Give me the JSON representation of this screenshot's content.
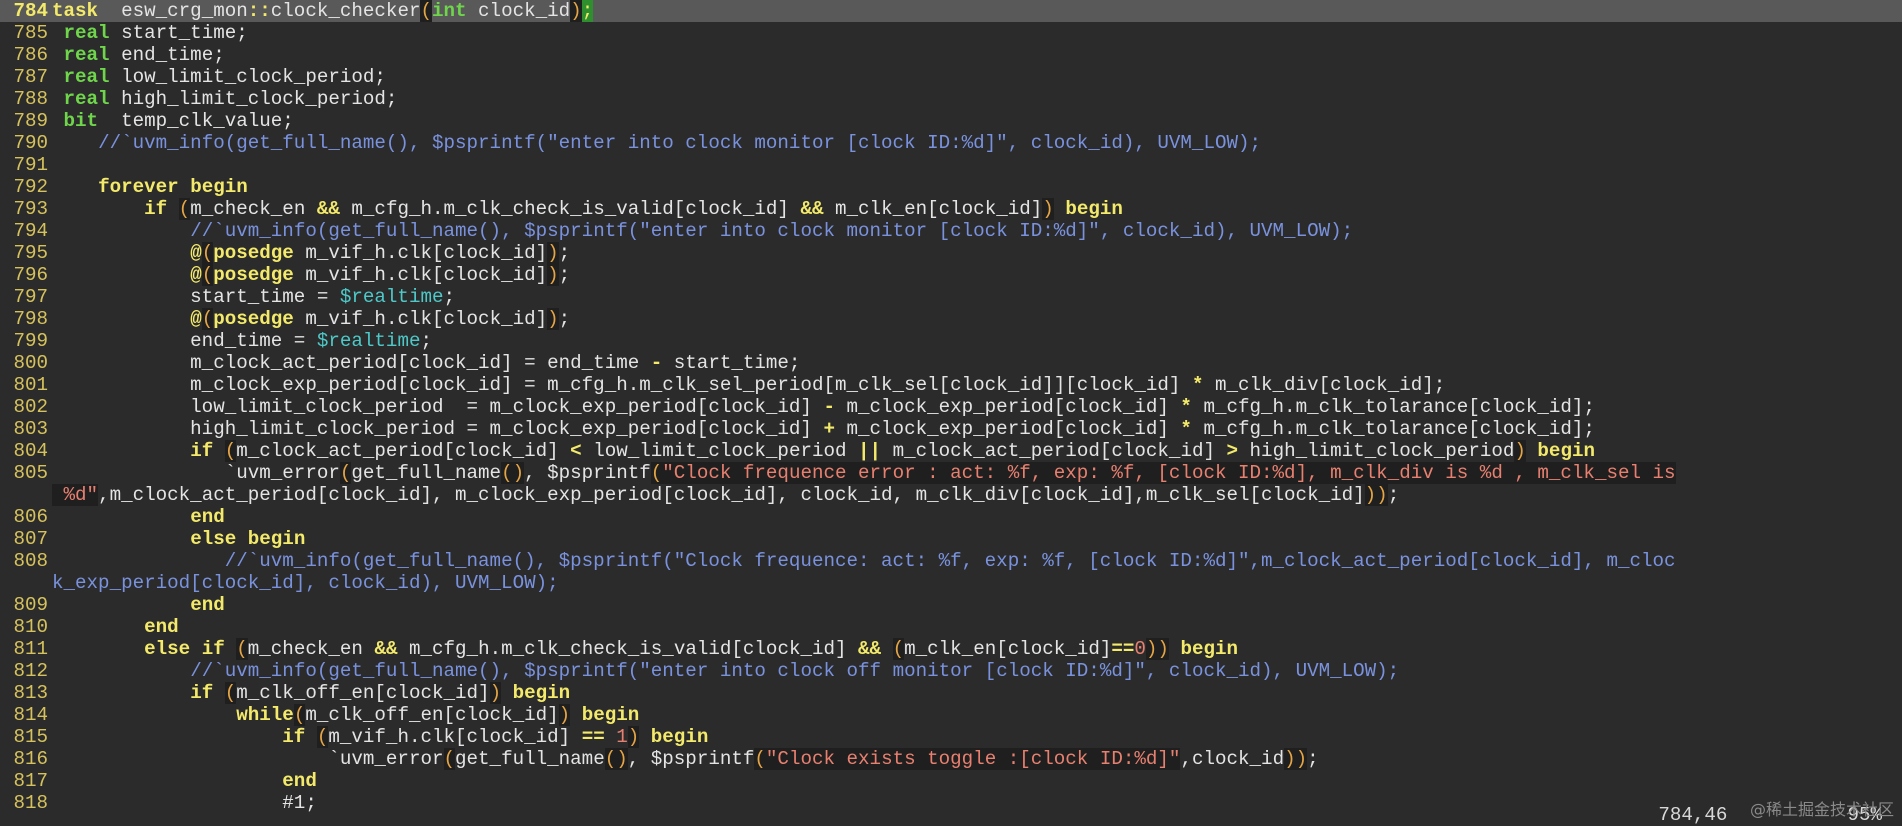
{
  "editor": {
    "lines": [
      {
        "n": "784",
        "cur": true,
        "t": [
          [
            "kw",
            "task"
          ],
          [
            "",
            "  esw_crg_mon"
          ],
          [
            "op",
            "::"
          ],
          [
            "",
            "clock_checker"
          ],
          [
            "pa",
            "("
          ],
          [
            "ty",
            "int"
          ],
          [
            "",
            " clock_id"
          ],
          [
            "pa",
            ")"
          ],
          [
            "cur",
            ";"
          ]
        ]
      },
      {
        "n": "785",
        "t": [
          [
            "",
            " "
          ],
          [
            "ty",
            "real"
          ],
          [
            "",
            " start_time;"
          ]
        ]
      },
      {
        "n": "786",
        "t": [
          [
            "",
            " "
          ],
          [
            "ty",
            "real"
          ],
          [
            "",
            " end_time;"
          ]
        ]
      },
      {
        "n": "787",
        "t": [
          [
            "",
            " "
          ],
          [
            "ty",
            "real"
          ],
          [
            "",
            " low_limit_clock_period;"
          ]
        ]
      },
      {
        "n": "788",
        "t": [
          [
            "",
            " "
          ],
          [
            "ty",
            "real"
          ],
          [
            "",
            " high_limit_clock_period;"
          ]
        ]
      },
      {
        "n": "789",
        "t": [
          [
            "",
            " "
          ],
          [
            "ty",
            "bit"
          ],
          [
            "",
            "  temp_clk_value;"
          ]
        ]
      },
      {
        "n": "790",
        "t": [
          [
            "",
            "    "
          ],
          [
            "cm",
            "//`uvm_info(get_full_name(), $psprintf(\"enter into clock monitor [clock ID:%d]\", clock_id), UVM_LOW);"
          ]
        ]
      },
      {
        "n": "791",
        "t": [
          [
            "",
            ""
          ]
        ]
      },
      {
        "n": "792",
        "t": [
          [
            "",
            "    "
          ],
          [
            "kw",
            "forever"
          ],
          [
            "",
            " "
          ],
          [
            "kw",
            "begin"
          ]
        ]
      },
      {
        "n": "793",
        "t": [
          [
            "",
            "        "
          ],
          [
            "kw",
            "if"
          ],
          [
            "",
            " "
          ],
          [
            "pa",
            "("
          ],
          [
            "",
            "m_check_en "
          ],
          [
            "op",
            "&&"
          ],
          [
            "",
            " m_cfg_h.m_clk_check_is_valid[clock_id] "
          ],
          [
            "op",
            "&&"
          ],
          [
            "",
            " m_clk_en[clock_id]"
          ],
          [
            "pa",
            ")"
          ],
          [
            "",
            " "
          ],
          [
            "kw",
            "begin"
          ]
        ]
      },
      {
        "n": "794",
        "t": [
          [
            "",
            "            "
          ],
          [
            "cm",
            "//`uvm_info(get_full_name(), $psprintf(\"enter into clock monitor [clock ID:%d]\", clock_id), UVM_LOW);"
          ]
        ]
      },
      {
        "n": "795",
        "t": [
          [
            "",
            "            "
          ],
          [
            "kw",
            "@"
          ],
          [
            "pa",
            "("
          ],
          [
            "kw",
            "posedge"
          ],
          [
            "",
            " m_vif_h.clk[clock_id]"
          ],
          [
            "pa",
            ")"
          ],
          [
            "",
            ";"
          ]
        ]
      },
      {
        "n": "796",
        "t": [
          [
            "",
            "            "
          ],
          [
            "kw",
            "@"
          ],
          [
            "pa",
            "("
          ],
          [
            "kw",
            "posedge"
          ],
          [
            "",
            " m_vif_h.clk[clock_id]"
          ],
          [
            "pa",
            ")"
          ],
          [
            "",
            ";"
          ]
        ]
      },
      {
        "n": "797",
        "t": [
          [
            "",
            "            start_time = "
          ],
          [
            "sy",
            "$realtime"
          ],
          [
            "",
            ";"
          ]
        ]
      },
      {
        "n": "798",
        "t": [
          [
            "",
            "            "
          ],
          [
            "kw",
            "@"
          ],
          [
            "pa",
            "("
          ],
          [
            "kw",
            "posedge"
          ],
          [
            "",
            " m_vif_h.clk[clock_id]"
          ],
          [
            "pa",
            ")"
          ],
          [
            "",
            ";"
          ]
        ]
      },
      {
        "n": "799",
        "t": [
          [
            "",
            "            end_time = "
          ],
          [
            "sy",
            "$realtime"
          ],
          [
            "",
            ";"
          ]
        ]
      },
      {
        "n": "800",
        "t": [
          [
            "",
            "            m_clock_act_period[clock_id] = end_time "
          ],
          [
            "op",
            "-"
          ],
          [
            "",
            " start_time;"
          ]
        ]
      },
      {
        "n": "801",
        "t": [
          [
            "",
            "            m_clock_exp_period[clock_id] = m_cfg_h.m_clk_sel_period[m_clk_sel[clock_id]][clock_id] "
          ],
          [
            "op",
            "*"
          ],
          [
            "",
            " m_clk_div[clock_id];"
          ]
        ]
      },
      {
        "n": "802",
        "t": [
          [
            "",
            "            low_limit_clock_period  = m_clock_exp_period[clock_id] "
          ],
          [
            "op",
            "-"
          ],
          [
            "",
            " m_clock_exp_period[clock_id] "
          ],
          [
            "op",
            "*"
          ],
          [
            "",
            " m_cfg_h.m_clk_tolarance[clock_id];"
          ]
        ]
      },
      {
        "n": "803",
        "t": [
          [
            "",
            "            high_limit_clock_period = m_clock_exp_period[clock_id] "
          ],
          [
            "op",
            "+"
          ],
          [
            "",
            " m_clock_exp_period[clock_id] "
          ],
          [
            "op",
            "*"
          ],
          [
            "",
            " m_cfg_h.m_clk_tolarance[clock_id];"
          ]
        ]
      },
      {
        "n": "804",
        "t": [
          [
            "",
            "            "
          ],
          [
            "kw",
            "if"
          ],
          [
            "",
            " "
          ],
          [
            "pa",
            "("
          ],
          [
            "",
            "m_clock_act_period[clock_id] "
          ],
          [
            "op",
            "<"
          ],
          [
            "",
            " low_limit_clock_period "
          ],
          [
            "op",
            "||"
          ],
          [
            "",
            " m_clock_act_period[clock_id] "
          ],
          [
            "op",
            ">"
          ],
          [
            "",
            " high_limit_clock_period"
          ],
          [
            "pa",
            ")"
          ],
          [
            "",
            " "
          ],
          [
            "kw",
            "begin"
          ]
        ]
      },
      {
        "n": "805",
        "t": [
          [
            "",
            "               `uvm_error"
          ],
          [
            "pa",
            "("
          ],
          [
            "",
            "get_full_name"
          ],
          [
            "pa",
            "()"
          ],
          [
            "",
            ", $psprintf"
          ],
          [
            "pa",
            "("
          ],
          [
            "st",
            "\"Clock frequence error : act: %f, exp: %f, [clock ID:%d], m_clk_div is %d , m_clk_sel is"
          ]
        ]
      },
      {
        "n": "",
        "t": [
          [
            "st",
            " %d\""
          ],
          [
            "",
            ",m_clock_act_period[clock_id], m_clock_exp_period[clock_id], clock_id, m_clk_div[clock_id],m_clk_sel[clock_id]"
          ],
          [
            "pa",
            "))"
          ],
          [
            "",
            ";"
          ]
        ]
      },
      {
        "n": "806",
        "t": [
          [
            "",
            "            "
          ],
          [
            "kw",
            "end"
          ]
        ]
      },
      {
        "n": "807",
        "t": [
          [
            "",
            "            "
          ],
          [
            "kw",
            "else"
          ],
          [
            "",
            " "
          ],
          [
            "kw",
            "begin"
          ]
        ]
      },
      {
        "n": "808",
        "t": [
          [
            "",
            "               "
          ],
          [
            "cm",
            "//`uvm_info(get_full_name(), $psprintf(\"Clock frequence: act: %f, exp: %f, [clock ID:%d]\",m_clock_act_period[clock_id], m_cloc"
          ]
        ]
      },
      {
        "n": "",
        "t": [
          [
            "cm",
            "k_exp_period[clock_id], clock_id), UVM_LOW);"
          ]
        ]
      },
      {
        "n": "809",
        "t": [
          [
            "",
            "            "
          ],
          [
            "kw",
            "end"
          ]
        ]
      },
      {
        "n": "810",
        "t": [
          [
            "",
            "        "
          ],
          [
            "kw",
            "end"
          ]
        ]
      },
      {
        "n": "811",
        "t": [
          [
            "",
            "        "
          ],
          [
            "kw",
            "else"
          ],
          [
            "",
            " "
          ],
          [
            "kw",
            "if"
          ],
          [
            "",
            " "
          ],
          [
            "pa",
            "("
          ],
          [
            "",
            "m_check_en "
          ],
          [
            "op",
            "&&"
          ],
          [
            "",
            " m_cfg_h.m_clk_check_is_valid[clock_id] "
          ],
          [
            "op",
            "&&"
          ],
          [
            "",
            " "
          ],
          [
            "pa",
            "("
          ],
          [
            "",
            "m_clk_en[clock_id]"
          ],
          [
            "op",
            "=="
          ],
          [
            "nu",
            "0"
          ],
          [
            "pa",
            "))"
          ],
          [
            "",
            " "
          ],
          [
            "kw",
            "begin"
          ]
        ]
      },
      {
        "n": "812",
        "t": [
          [
            "",
            "            "
          ],
          [
            "cm",
            "//`uvm_info(get_full_name(), $psprintf(\"enter into clock off monitor [clock ID:%d]\", clock_id), UVM_LOW);"
          ]
        ]
      },
      {
        "n": "813",
        "t": [
          [
            "",
            "            "
          ],
          [
            "kw",
            "if"
          ],
          [
            "",
            " "
          ],
          [
            "pa",
            "("
          ],
          [
            "",
            "m_clk_off_en[clock_id]"
          ],
          [
            "pa",
            ")"
          ],
          [
            "",
            " "
          ],
          [
            "kw",
            "begin"
          ]
        ]
      },
      {
        "n": "814",
        "t": [
          [
            "",
            "                "
          ],
          [
            "kw",
            "while"
          ],
          [
            "pa",
            "("
          ],
          [
            "",
            "m_clk_off_en[clock_id]"
          ],
          [
            "pa",
            ")"
          ],
          [
            "",
            " "
          ],
          [
            "kw",
            "begin"
          ]
        ]
      },
      {
        "n": "815",
        "t": [
          [
            "",
            "                    "
          ],
          [
            "kw",
            "if"
          ],
          [
            "",
            " "
          ],
          [
            "pa",
            "("
          ],
          [
            "",
            "m_vif_h.clk[clock_id] "
          ],
          [
            "op",
            "=="
          ],
          [
            "",
            " "
          ],
          [
            "nu",
            "1"
          ],
          [
            "pa",
            ")"
          ],
          [
            "",
            " "
          ],
          [
            "kw",
            "begin"
          ]
        ]
      },
      {
        "n": "816",
        "t": [
          [
            "",
            "                        `uvm_error"
          ],
          [
            "pa",
            "("
          ],
          [
            "",
            "get_full_name"
          ],
          [
            "pa",
            "()"
          ],
          [
            "",
            ", $psprintf"
          ],
          [
            "pa",
            "("
          ],
          [
            "st",
            "\"Clock exists toggle :[clock ID:%d]\""
          ],
          [
            "",
            ",clock_id"
          ],
          [
            "pa",
            "))"
          ],
          [
            "",
            ";"
          ]
        ]
      },
      {
        "n": "817",
        "t": [
          [
            "",
            "                    "
          ],
          [
            "kw",
            "end"
          ]
        ]
      },
      {
        "n": "818",
        "t": [
          [
            "",
            "                    #1;"
          ]
        ]
      }
    ]
  },
  "ruler": {
    "position": "784,46",
    "percent": "95%"
  },
  "watermark": "@稀土掘金技术社区"
}
